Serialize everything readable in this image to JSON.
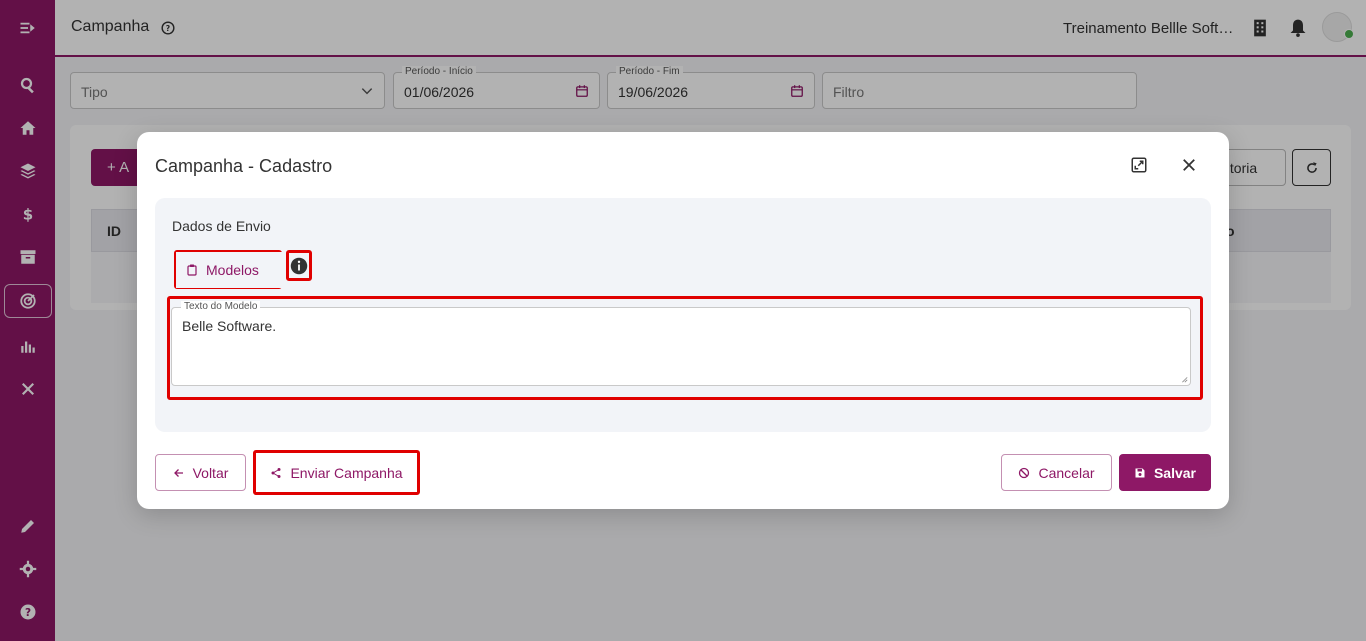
{
  "header": {
    "title": "Campanha",
    "company": "Treinamento Bellle Software"
  },
  "filters": {
    "tipo_placeholder": "Tipo",
    "inicio_label": "Período - Início",
    "inicio_value": "01/06/2026",
    "fim_label": "Período - Fim",
    "fim_value": "19/06/2026",
    "filtro_placeholder": "Filtro"
  },
  "background": {
    "add_button": "+ A",
    "auditoria_button": "ditoria",
    "col_id": "ID",
    "col_partial": "o"
  },
  "modal": {
    "title": "Campanha - Cadastro",
    "section_title": "Dados de Envio",
    "modelos_button": "Modelos",
    "textarea_label": "Texto do Modelo",
    "textarea_value": "Belle Software.",
    "voltar_button": "Voltar",
    "enviar_button": "Enviar Campanha",
    "cancelar_button": "Cancelar",
    "salvar_button": "Salvar"
  },
  "colors": {
    "brand": "#8e1866",
    "highlight": "#e00000"
  }
}
